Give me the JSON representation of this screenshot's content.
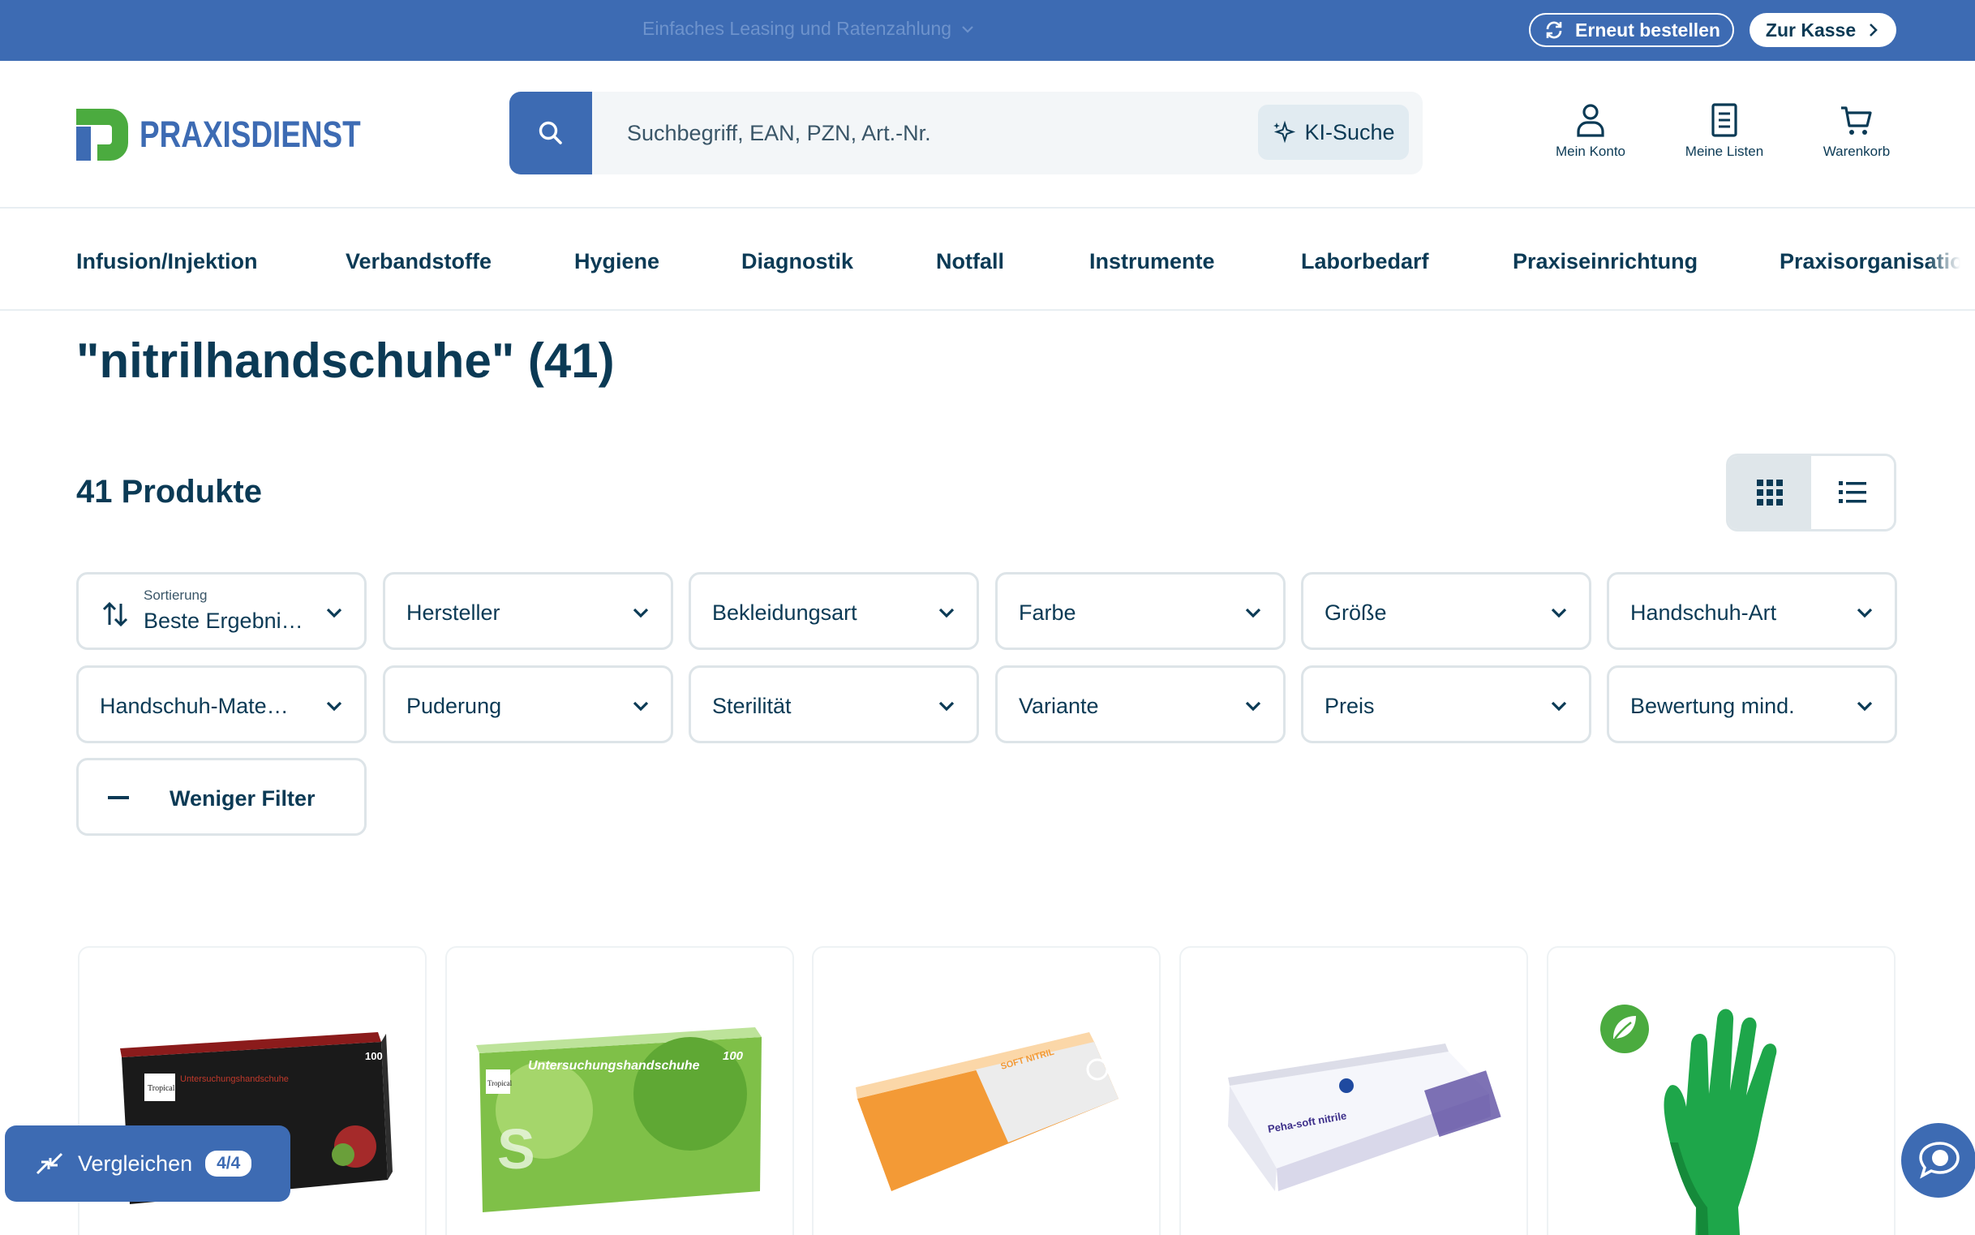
{
  "topbar": {
    "promo": "Einfaches Leasing und Ratenzahlung",
    "reorder_label": "Erneut bestellen",
    "checkout_label": "Zur Kasse"
  },
  "header": {
    "logo_text": "PRAXISDIENST",
    "search_placeholder": "Suchbegriff, EAN, PZN, Art.-Nr.",
    "ki_search_label": "KI-Suche",
    "account_label": "Mein Konto",
    "lists_label": "Meine Listen",
    "cart_label": "Warenkorb"
  },
  "nav": {
    "items": [
      {
        "label": "Infusion/Injektion"
      },
      {
        "label": "Verbandstoffe"
      },
      {
        "label": "Hygiene"
      },
      {
        "label": "Diagnostik"
      },
      {
        "label": "Notfall"
      },
      {
        "label": "Instrumente"
      },
      {
        "label": "Laborbedarf"
      },
      {
        "label": "Praxiseinrichtung"
      },
      {
        "label": "Praxisorganisation"
      }
    ]
  },
  "results": {
    "title": "\"nitrilhandschuhe\" (41)",
    "count_label": "41 Produkte"
  },
  "filters": {
    "sort_caption": "Sortierung",
    "sort_value": "Beste Ergebnisse",
    "items": [
      {
        "label": "Hersteller"
      },
      {
        "label": "Bekleidungsart"
      },
      {
        "label": "Farbe"
      },
      {
        "label": "Größe"
      },
      {
        "label": "Handschuh-Art"
      },
      {
        "label": "Handschuh-Material"
      },
      {
        "label": "Puderung"
      },
      {
        "label": "Sterilität"
      },
      {
        "label": "Variante"
      },
      {
        "label": "Preis"
      },
      {
        "label": "Bewertung mind."
      }
    ],
    "less_label": "Weniger Filter"
  },
  "compare": {
    "label": "Vergleichen",
    "count": "4/4"
  },
  "products": [
    {
      "brand": "Tropical",
      "box_text": "Untersuchungshandschuhe",
      "count": "100",
      "color": "#1a1a1a"
    },
    {
      "brand": "Tropical",
      "box_text": "Untersuchungshandschuhe",
      "count": "100",
      "color": "#6cb33f"
    },
    {
      "brand": "",
      "box_text": "SOFT NITRIL",
      "count": "",
      "color": "#f39a36"
    },
    {
      "brand": "",
      "box_text": "Peha-soft nitrile",
      "count": "",
      "color": "#5e4fa2"
    },
    {
      "brand": "",
      "box_text": "",
      "count": "",
      "color": "#1ea64a"
    }
  ],
  "colors": {
    "brand_blue": "#3d6bb3",
    "text_dark": "#0b3a55",
    "logo_green": "#4bab3f"
  }
}
